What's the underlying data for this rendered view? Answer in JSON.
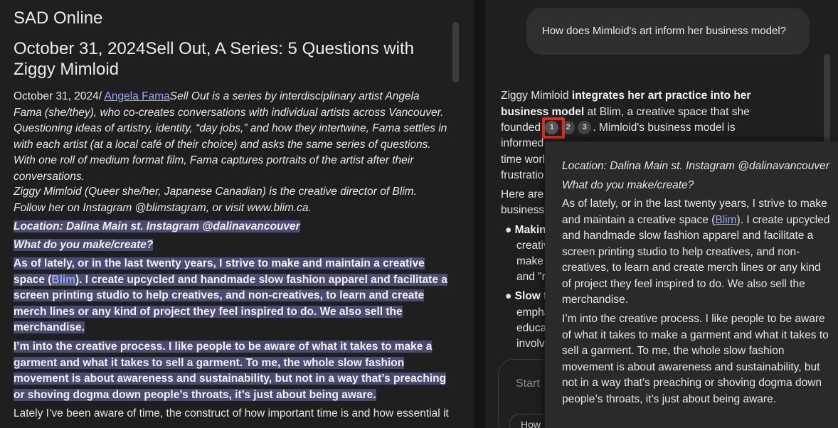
{
  "left": {
    "site_title": "SAD Online",
    "page_title": "October 31, 2024Sell Out, A Series: 5 Questions with Ziggy Mimloid",
    "byline_date": "October 31, 2024/ ",
    "author_link": "Angela Fama",
    "intro_italic": "Sell Out is a series by interdisciplinary artist Angela Fama (she/they), who co-creates conversations with individual artists across Vancouver. Questioning ideas of artistry, identity, “day jobs,” and how they intertwine, Fama settles in with each artist (at a local café of their choice) and asks the same series of questions. With one roll of medium format film, Fama captures portraits of the artist after their conversations.",
    "intro_2": "Ziggy Mimloid (Queer she/her, Japanese Canadian) is the creative director of Blim. Follow her on Instagram @blimstagram, or visit www.blim.ca.",
    "location": "Location: Dalina Main st. Instagram @dalinavancouver",
    "question": "What do you make/create?",
    "answer1_pre": "As of lately, or in the last twenty years, I strive to make and maintain a creative space (",
    "answer1_link": "Blim",
    "answer1_post": "). I create upcycled and handmade slow fashion apparel and facilitate a screen printing studio to help creatives, and non-creatives, to learn and create merch lines or any kind of project they feel inspired to do. We also sell the merchandise.",
    "answer2": "I’m into the creative process. I like people to be aware of what it takes to make a garment and what it takes to sell a garment. To me, the whole slow fashion movement is about awareness and sustainability, but not in a way that’s preaching or shoving dogma down people’s throats, it’s just about being aware.",
    "lately": "Lately I’ve been aware of time, the construct of how important time is and how essential it"
  },
  "right": {
    "user_question": "How does Mimloid's art inform her business model?",
    "answer_start": "Ziggy Mimloid ",
    "answer_bold": "integrates her art practice into her business model",
    "answer_mid": " at Blim, a creative space that she founded",
    "citations": [
      "1",
      "2",
      "3"
    ],
    "answer_after": ". Mimloid's business model is",
    "trunc_lines": [
      "informed",
      "time worl",
      "frustratio",
      "Here are",
      "business"
    ],
    "bullet1_head": "Makin",
    "bullet1_lines": [
      "creativ",
      "make",
      "and \"r"
    ],
    "bullet2_head": "Slow f",
    "bullet2_lines": [
      "empha",
      "educa",
      "involv"
    ],
    "input_placeholder": "Start",
    "chip_label": "How"
  },
  "popup": {
    "location": "Location: Dalina Main st. Instagram @dalinavancouver",
    "question": "What do you make/create?",
    "answer1_pre": "As of lately, or in the last twenty years, I strive to make and maintain a creative space (",
    "answer1_link": "Blim",
    "answer1_post": "). I create upcycled and handmade slow fashion apparel and facilitate a screen printing studio to help creatives, and non-creatives, to learn and create merch lines or any kind of project they feel inspired to do. We also sell the merchandise.",
    "answer2": "I’m into the creative process. I like people to be aware of what it takes to make a garment and what it takes to sell a garment. To me, the whole slow fashion movement is about awareness and sustainability, but not in a way that’s preaching or shoving dogma down people’s throats, it’s just about being aware."
  }
}
